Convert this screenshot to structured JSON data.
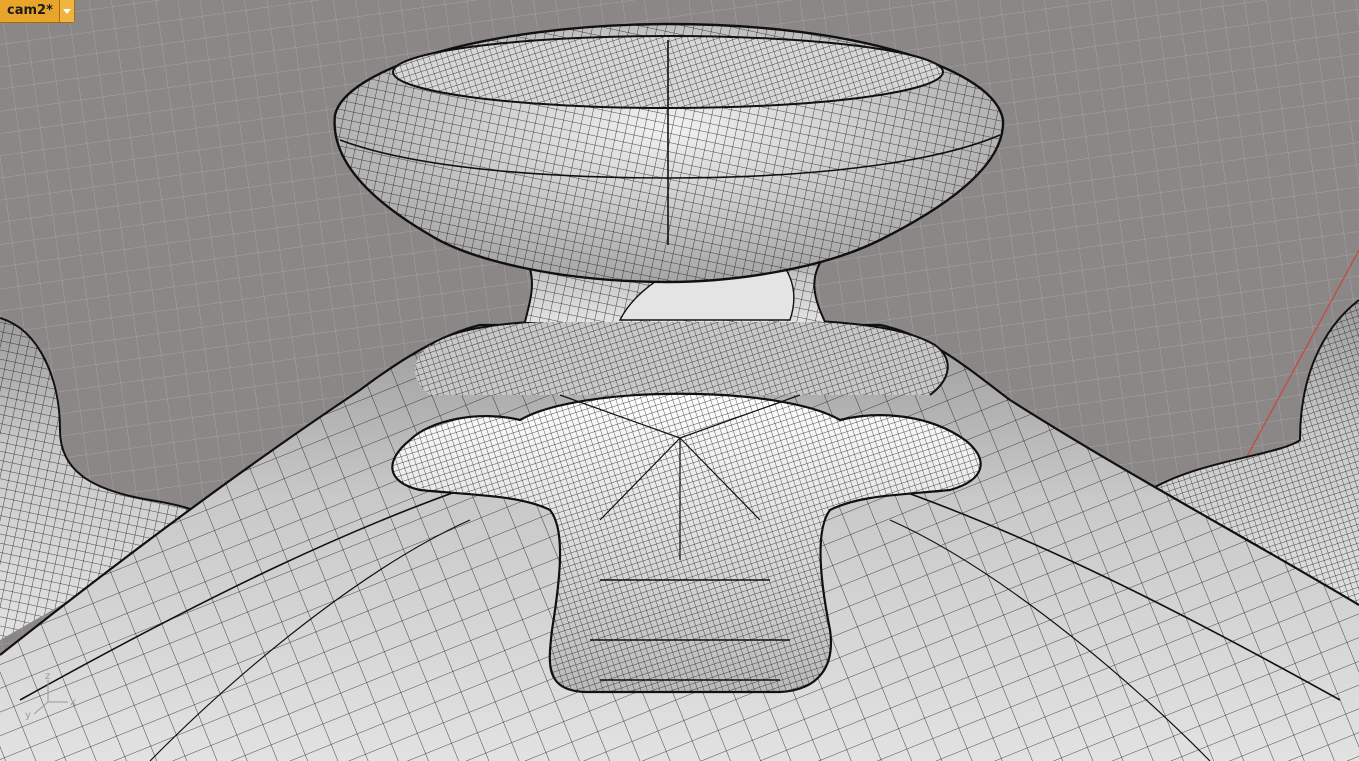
{
  "viewport": {
    "camera_label": "cam2*",
    "shading_mode": "wireframe-on-shaded",
    "colors": {
      "background": "#8a8786",
      "grid_line": "#a6a3a1",
      "surface": "#dcdcdc",
      "wire": "#1a1a1a",
      "camera_tab": "#e8a52a",
      "x_axis": "#c9463e"
    }
  },
  "axis_gizmo": {
    "x_label": "x",
    "y_label": "y",
    "z_label": "z"
  }
}
